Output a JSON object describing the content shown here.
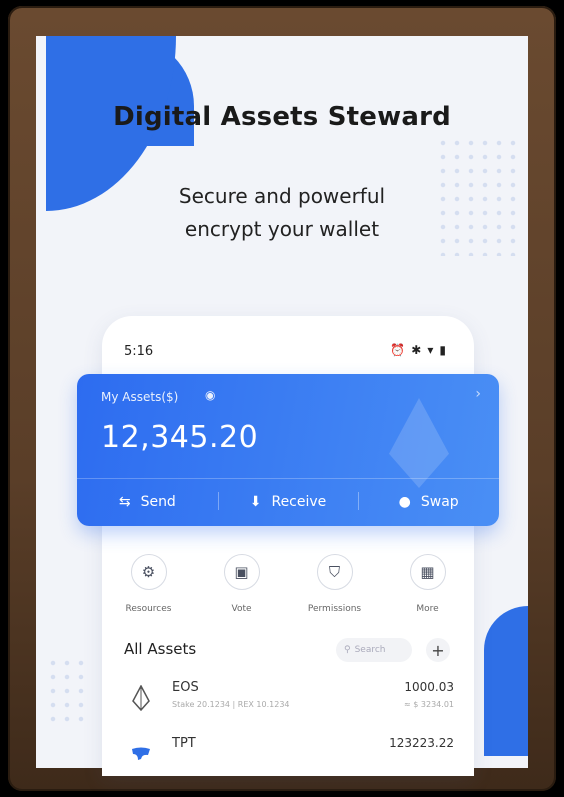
{
  "promo": {
    "headline": "Digital Assets Steward",
    "sub_line1": "Secure and powerful",
    "sub_line2": "encrypt your wallet"
  },
  "status_bar": {
    "time": "5:16",
    "icons": [
      "alarm-icon",
      "bluetooth-icon",
      "wifi-icon",
      "battery-icon"
    ]
  },
  "card": {
    "label": "My Assets($)",
    "amount": "12,345.20",
    "actions": [
      {
        "label": "Send",
        "icon": "send-icon"
      },
      {
        "label": "Receive",
        "icon": "receive-icon"
      },
      {
        "label": "Swap",
        "icon": "swap-icon"
      }
    ]
  },
  "shortcuts": [
    {
      "label": "Resources",
      "icon": "resources-icon"
    },
    {
      "label": "Vote",
      "icon": "vote-icon"
    },
    {
      "label": "Permissions",
      "icon": "shield-icon"
    },
    {
      "label": "More",
      "icon": "grid-icon"
    }
  ],
  "assets": {
    "title": "All Assets",
    "search_placeholder": "Search",
    "items": [
      {
        "name": "EOS",
        "meta": "Stake 20.1234 | REX 10.1234",
        "amount": "1000.03",
        "fiat": "≈ $ 3234.01"
      },
      {
        "name": "TPT",
        "meta": "",
        "amount": "123223.22",
        "fiat": ""
      }
    ]
  },
  "colors": {
    "accent": "#2f6fe6",
    "card_gradient_end": "#4a8ff5",
    "frame": "#6a4a30"
  }
}
